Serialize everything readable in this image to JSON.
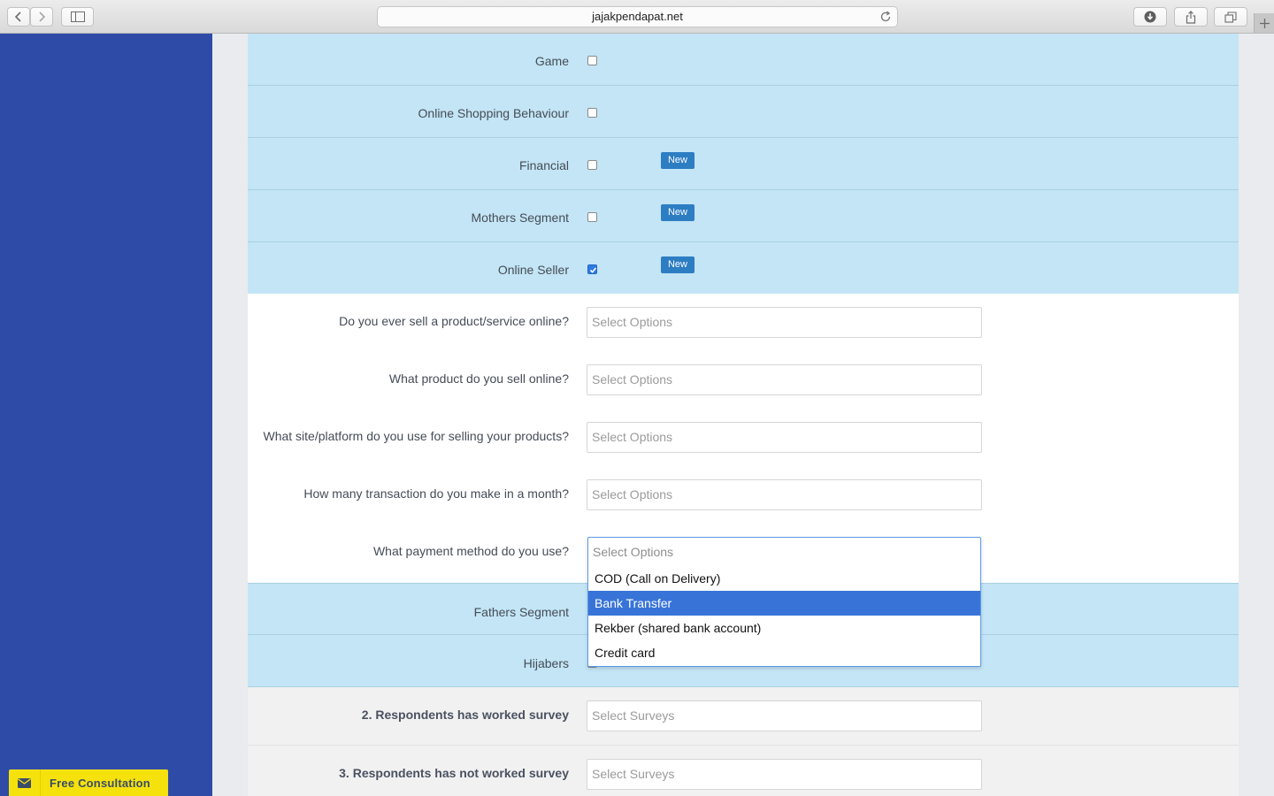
{
  "browser": {
    "url": "jajakpendapat.net"
  },
  "sidebar": {
    "consult_label": "Free Consultation"
  },
  "segments": [
    {
      "label": "Game",
      "checked": false,
      "badge": ""
    },
    {
      "label": "Online Shopping Behaviour",
      "checked": false,
      "badge": ""
    },
    {
      "label": "Financial",
      "checked": false,
      "badge": "New"
    },
    {
      "label": "Mothers Segment",
      "checked": false,
      "badge": "New"
    },
    {
      "label": "Online Seller",
      "checked": true,
      "badge": "New"
    }
  ],
  "online_seller_questions": [
    {
      "label": "Do you ever sell a product/service online?",
      "placeholder": "Select Options"
    },
    {
      "label": "What product do you sell online?",
      "placeholder": "Select Options"
    },
    {
      "label": "What site/platform do you use for selling your products?",
      "placeholder": "Select Options"
    },
    {
      "label": "How many transaction do you make in a month?",
      "placeholder": "Select Options"
    },
    {
      "label": "What payment method do you use?",
      "placeholder": "Select Options"
    }
  ],
  "payment_dropdown": {
    "placeholder": "Select Options",
    "options": [
      "COD (Call on Delivery)",
      "Bank Transfer",
      "Rekber (shared bank account)",
      "Credit card"
    ],
    "highlighted": "Bank Transfer"
  },
  "more_segments": [
    {
      "label": "Fathers Segment"
    },
    {
      "label": "Hijabers"
    }
  ],
  "survey_filters": [
    {
      "label": "2. Respondents has worked survey",
      "placeholder": "Select Surveys"
    },
    {
      "label": "3. Respondents has not worked survey",
      "placeholder": "Select Surveys"
    }
  ],
  "colors": {
    "sidebar": "#2f4ba8",
    "segment_row": "#c3e5f5",
    "badge": "#2d7dc3",
    "highlight": "#3874d8",
    "consult_button": "#f5e20c"
  }
}
